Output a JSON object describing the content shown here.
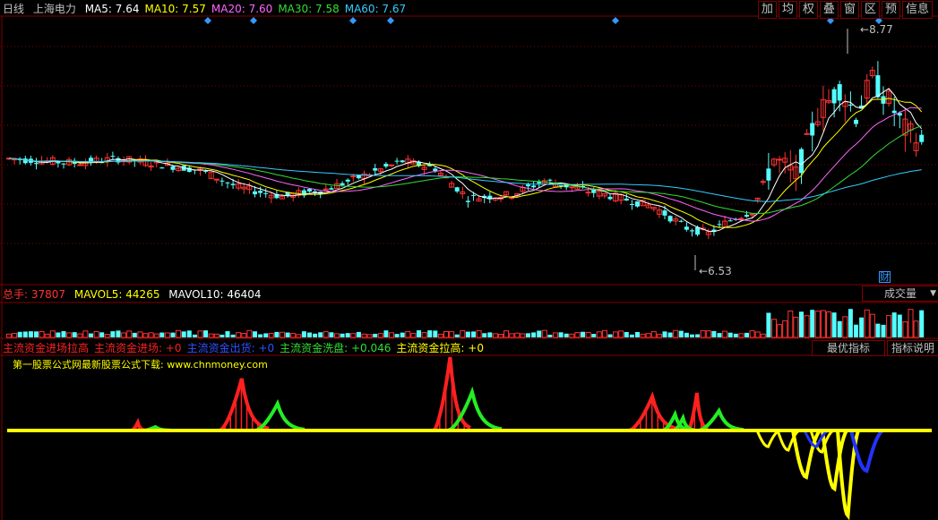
{
  "header": {
    "period": "日线",
    "stock_name": "上海电力",
    "ma": [
      {
        "label": "MA5: 7.64",
        "color": "#ffffff"
      },
      {
        "label": "MA10: 7.57",
        "color": "#ffff00"
      },
      {
        "label": "MA20: 7.60",
        "color": "#ff66ff"
      },
      {
        "label": "MA30: 7.58",
        "color": "#33dd33"
      },
      {
        "label": "MA60: 7.67",
        "color": "#33ccff"
      }
    ]
  },
  "toolbar": [
    "加",
    "均",
    "权",
    "叠",
    "窗",
    "区",
    "预",
    "信息"
  ],
  "price_annotations": {
    "high": "8.77",
    "low": "6.53",
    "marker": "财"
  },
  "volume_header": {
    "total": "总手: 37807",
    "mavol5": "MAVOL5: 44265",
    "mavol10": "MAVOL10: 46404",
    "selector": "成交量",
    "selector_arrow": "▼"
  },
  "indicator_header": {
    "items": [
      {
        "label": "主流资金进场拉高",
        "color": "#ff2020"
      },
      {
        "label": "主流资金进场: +0",
        "color": "#ff2020"
      },
      {
        "label": "主流资金出货: +0",
        "color": "#3050ff"
      },
      {
        "label": "主流资金洗盘: +0.046",
        "color": "#33dd33"
      },
      {
        "label": "主流资金拉高: +0",
        "color": "#ffff00"
      }
    ],
    "btn_best": "最优指标",
    "btn_explain": "指标说明",
    "watermark": "第一股票公式网最新股票公式下载: www.chnmoney.com"
  },
  "colors": {
    "up": "#ff3232",
    "down": "#54ffff",
    "grid": "#7f0000",
    "ma5": "#ffffff",
    "ma10": "#ffff00",
    "ma20": "#ff66ff",
    "ma30": "#33dd33",
    "ma60": "#33ccff",
    "diamond": "#3399ff",
    "ind_red": "#ff2020",
    "ind_green": "#22ee22",
    "ind_yellow": "#ffff00",
    "ind_blue": "#2233ff"
  },
  "chart_data": {
    "type": "candlestick",
    "price_range": [
      6.2,
      8.95
    ],
    "price_high": 8.77,
    "price_low": 6.53,
    "last_ma": {
      "ma5": 7.64,
      "ma10": 7.57,
      "ma20": 7.6,
      "ma30": 7.58,
      "ma60": 7.67
    },
    "volume": {
      "total": 37807,
      "mavol5": 44265,
      "mavol10": 46404
    },
    "indicator": {
      "jinchang": 0,
      "chuhuo": 0,
      "xipan": 0.046,
      "lagao": 0
    }
  }
}
